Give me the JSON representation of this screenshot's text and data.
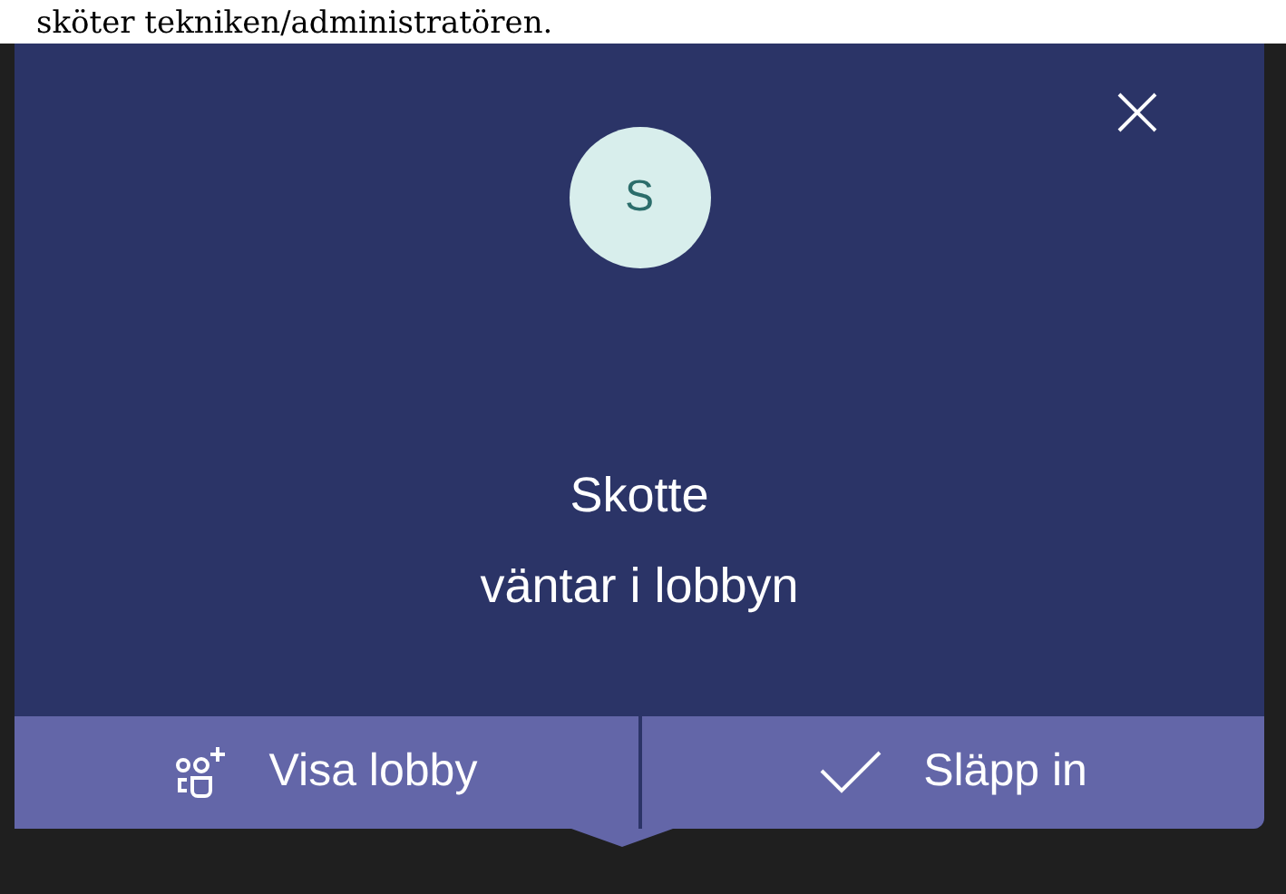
{
  "background_text": "sköter tekniken/administratören.",
  "notification": {
    "avatar_initial": "S",
    "name": "Skotte",
    "message": "väntar i lobbyn"
  },
  "actions": [
    {
      "kind": "lobby",
      "label": "Visa lobby"
    },
    {
      "kind": "admit",
      "label": "Släpp in"
    }
  ]
}
